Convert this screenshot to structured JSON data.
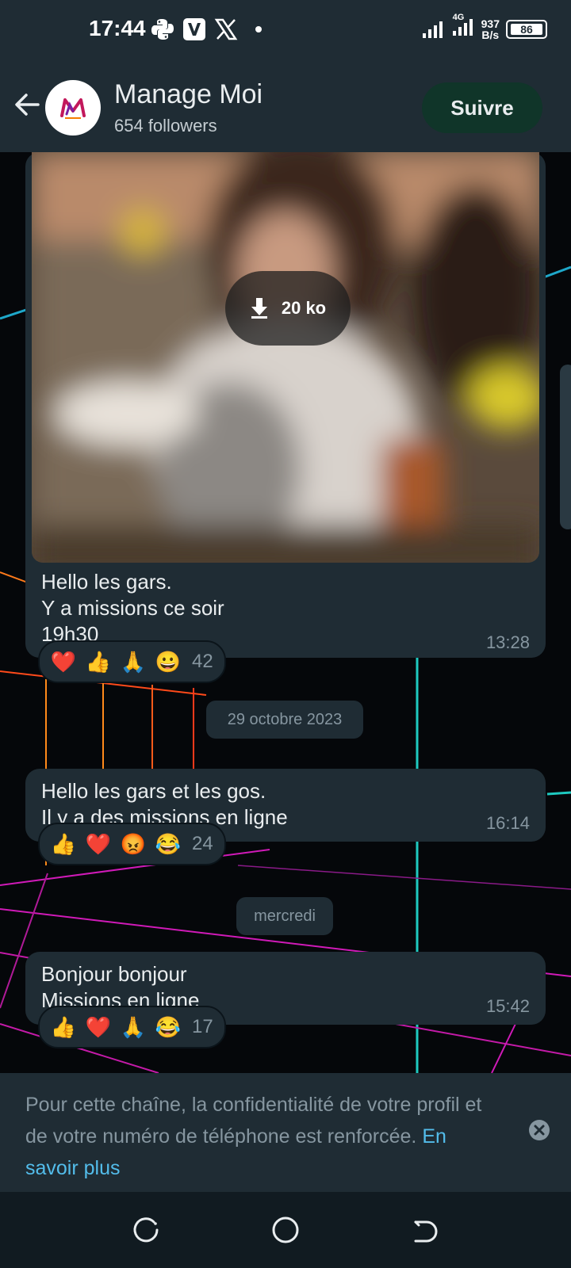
{
  "status_bar": {
    "time": "17:44",
    "app_icons": [
      "python-icon",
      "v-app-icon",
      "x-icon"
    ],
    "network_type": "4G",
    "speed_value": "937",
    "speed_unit": "B/s",
    "battery": "86"
  },
  "header": {
    "channel_name": "Manage Moi",
    "followers": "654 followers",
    "follow_label": "Suivre",
    "avatar_monogram": "M"
  },
  "messages": [
    {
      "media": {
        "download_size": "20 ko"
      },
      "text": "Hello les gars.\nY a missions ce soir\n19h30",
      "time": "13:28",
      "reactions": [
        "❤️",
        "👍",
        "🙏",
        "😀"
      ],
      "reaction_count": "42"
    },
    {
      "date_separator": "29 octobre 2023",
      "text": "Hello les gars et les gos.\nIl y a des missions en ligne",
      "time": "16:14",
      "reactions": [
        "👍",
        "❤️",
        "😡",
        "😂"
      ],
      "reaction_count": "24"
    },
    {
      "date_separator": "mercredi",
      "text": "Bonjour bonjour\nMissions en ligne",
      "time": "15:42",
      "reactions": [
        "👍",
        "❤️",
        "🙏",
        "😂"
      ],
      "reaction_count": "17"
    }
  ],
  "notice": {
    "text": "Pour cette chaîne, la confidentialité de votre profil et de votre numéro de téléphone est renforcée.",
    "link": "En savoir plus"
  },
  "nav": [
    "recent-apps-icon",
    "home-icon",
    "back-icon"
  ],
  "colors": {
    "header_bg": "#1f2c34",
    "bubble_bg": "#1f2c34",
    "follow_bg": "#103529",
    "link": "#53bdeb",
    "secondary_text": "#8696a0"
  }
}
